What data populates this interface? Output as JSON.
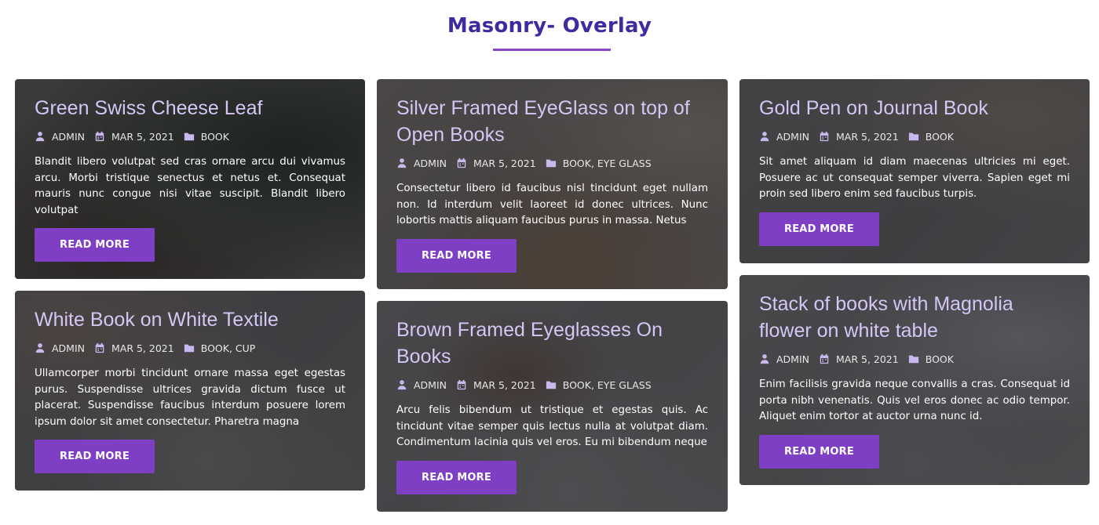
{
  "section": {
    "title": "Masonry- Overlay"
  },
  "colors": {
    "title": "#3f2aa0",
    "accent": "#7f3fc4",
    "post_title": "#d4c6f5",
    "overlay": "#3a3a3d"
  },
  "posts": [
    {
      "title": "Green Swiss Cheese Leaf",
      "author": "ADMIN",
      "date": "MAR 5, 2021",
      "categories": [
        "BOOK"
      ],
      "excerpt": "Blandit libero volutpat sed cras ornare arcu dui vivamus arcu. Morbi tristique senectus et netus et. Consequat mauris nunc congue nisi vitae suscipit. Blandit libero volutpat",
      "button": "READ MORE"
    },
    {
      "title": "Silver Framed EyeGlass on top of Open Books",
      "author": "ADMIN",
      "date": "MAR 5, 2021",
      "categories": [
        "BOOK",
        "EYE GLASS"
      ],
      "excerpt": "Consectetur libero id faucibus nisl tincidunt eget nullam non. Id interdum velit laoreet id donec ultrices. Nunc lobortis mattis aliquam faucibus purus in massa. Netus",
      "button": "READ MORE"
    },
    {
      "title": "Gold Pen on Journal Book",
      "author": "ADMIN",
      "date": "MAR 5, 2021",
      "categories": [
        "BOOK"
      ],
      "excerpt": "Sit amet aliquam id diam maecenas ultricies mi eget. Posuere ac ut consequat semper viverra. Sapien eget mi proin sed libero enim sed faucibus turpis.",
      "button": "READ MORE"
    },
    {
      "title": "White Book on White Textile",
      "author": "ADMIN",
      "date": "MAR 5, 2021",
      "categories": [
        "BOOK",
        "CUP"
      ],
      "excerpt": "Ullamcorper morbi tincidunt ornare massa eget egestas purus. Suspendisse ultrices gravida dictum fusce ut placerat. Suspendisse faucibus interdum posuere lorem ipsum dolor sit amet consectetur. Pharetra magna",
      "button": "READ MORE"
    },
    {
      "title": "Brown Framed Eyeglasses On Books",
      "author": "ADMIN",
      "date": "MAR 5, 2021",
      "categories": [
        "BOOK",
        "EYE GLASS"
      ],
      "excerpt": "Arcu felis bibendum ut tristique et egestas quis. Ac tincidunt vitae semper quis lectus nulla at volutpat diam. Condimentum lacinia quis vel eros. Eu mi bibendum neque",
      "button": "READ MORE"
    },
    {
      "title": "Stack of books with Magnolia flower on white table",
      "author": "ADMIN",
      "date": "MAR 5, 2021",
      "categories": [
        "BOOK"
      ],
      "excerpt": "Enim facilisis gravida neque convallis a cras. Consequat id porta nibh venenatis. Quis vel eros donec ac odio tempor. Aliquet enim tortor at auctor urna nunc id.",
      "button": "READ MORE"
    }
  ],
  "icons": {
    "author": "user-icon",
    "date": "calendar-icon",
    "category": "folder-icon"
  }
}
